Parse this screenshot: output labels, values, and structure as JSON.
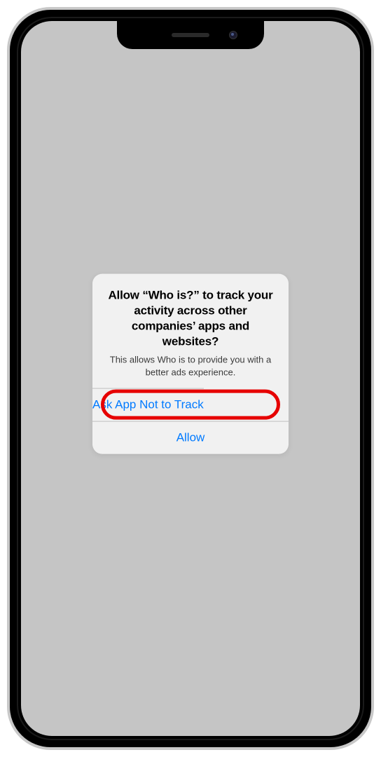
{
  "dialog": {
    "title": "Allow “Who is?” to track your activity across other companies’ apps and websites?",
    "message": "This allows Who is to provide you with a better ads experience.",
    "buttons": {
      "deny": "Ask App Not to Track",
      "allow": "Allow"
    }
  }
}
